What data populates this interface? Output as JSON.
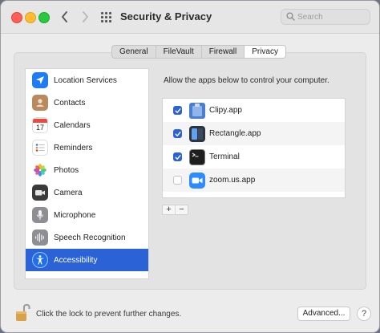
{
  "window": {
    "title": "Security & Privacy"
  },
  "search": {
    "placeholder": "Search"
  },
  "tabs": [
    {
      "label": "General",
      "active": false
    },
    {
      "label": "FileVault",
      "active": false
    },
    {
      "label": "Firewall",
      "active": false
    },
    {
      "label": "Privacy",
      "active": true
    }
  ],
  "sidebar": {
    "selected": "Accessibility",
    "items": [
      {
        "label": "Location Services",
        "icon": "location-arrow-icon"
      },
      {
        "label": "Contacts",
        "icon": "contacts-icon"
      },
      {
        "label": "Calendars",
        "icon": "calendar-icon",
        "icon_text": "17"
      },
      {
        "label": "Reminders",
        "icon": "reminders-icon"
      },
      {
        "label": "Photos",
        "icon": "photos-icon"
      },
      {
        "label": "Camera",
        "icon": "camera-icon"
      },
      {
        "label": "Microphone",
        "icon": "microphone-icon"
      },
      {
        "label": "Speech Recognition",
        "icon": "speech-waveform-icon"
      },
      {
        "label": "Accessibility",
        "icon": "accessibility-icon"
      }
    ]
  },
  "privacy": {
    "description": "Allow the apps below to control your computer.",
    "apps": [
      {
        "name": "Clipy.app",
        "checked": true,
        "icon": "clipy-app-icon"
      },
      {
        "name": "Rectangle.app",
        "checked": true,
        "icon": "rectangle-app-icon"
      },
      {
        "name": "Terminal",
        "checked": true,
        "icon": "terminal-app-icon"
      },
      {
        "name": "zoom.us.app",
        "checked": false,
        "icon": "zoom-app-icon"
      }
    ],
    "add_label": "+",
    "remove_label": "−"
  },
  "footer": {
    "lock_text": "Click the lock to prevent further changes.",
    "advanced_label": "Advanced...",
    "help_label": "?"
  },
  "colors": {
    "accent": "#2b63d6",
    "window_bg": "#ececec",
    "close": "#fe5f57",
    "minimize": "#febc2e",
    "zoom": "#28c840"
  }
}
